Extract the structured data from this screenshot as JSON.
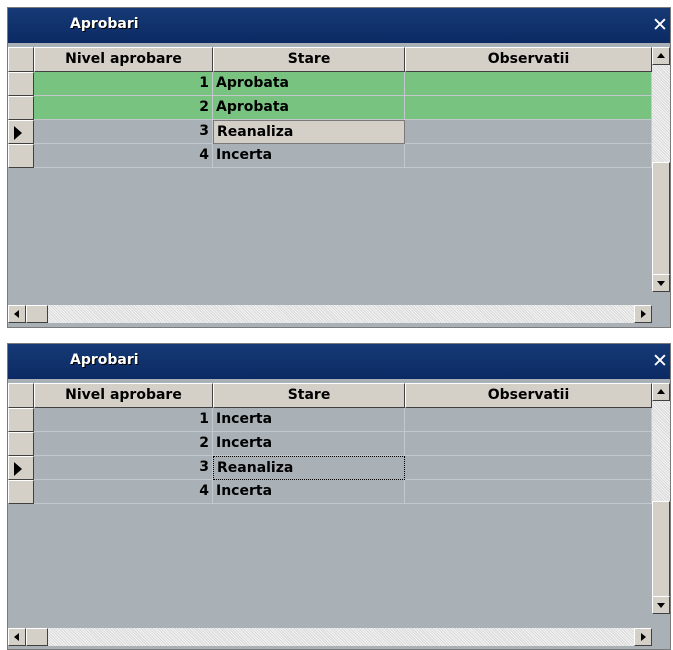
{
  "windows": [
    {
      "title": "Aprobari",
      "close_glyph": "✕",
      "columns": [
        "Nivel aprobare",
        "Stare",
        "Observatii"
      ],
      "rows": [
        {
          "nivel": "1",
          "stare": "Aprobata",
          "observatii": "",
          "color": "#79c381"
        },
        {
          "nivel": "2",
          "stare": "Aprobata",
          "observatii": "",
          "color": "#79c381"
        },
        {
          "nivel": "3",
          "stare": "Reanaliza",
          "observatii": "",
          "current": true
        },
        {
          "nivel": "4",
          "stare": "Incerta",
          "observatii": ""
        }
      ]
    },
    {
      "title": "Aprobari",
      "close_glyph": "✕",
      "columns": [
        "Nivel aprobare",
        "Stare",
        "Observatii"
      ],
      "rows": [
        {
          "nivel": "1",
          "stare": "Incerta",
          "observatii": ""
        },
        {
          "nivel": "2",
          "stare": "Incerta",
          "observatii": ""
        },
        {
          "nivel": "3",
          "stare": "Reanaliza",
          "observatii": "",
          "current": true
        },
        {
          "nivel": "4",
          "stare": "Incerta",
          "observatii": ""
        }
      ]
    }
  ],
  "colors": {
    "titlebar": "#0b2a63",
    "grid_background": "#a9b1b6",
    "approved_row": "#79c381",
    "button_face": "#d4d0c8"
  }
}
